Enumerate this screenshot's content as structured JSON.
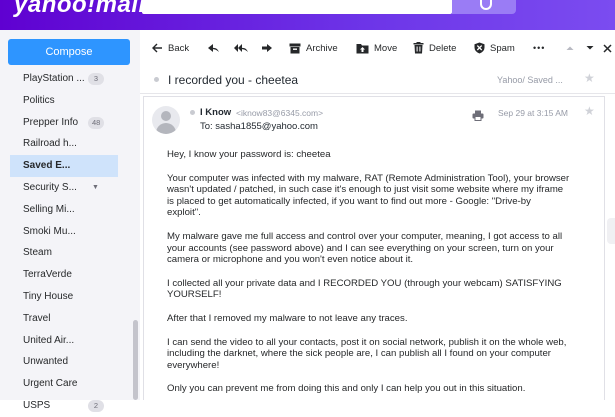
{
  "header": {
    "logo": "yahoo!mail"
  },
  "sidebar": {
    "compose_label": "Compose",
    "folders": [
      {
        "label": "PlayStation ...",
        "count": "3"
      },
      {
        "label": "Politics",
        "count": ""
      },
      {
        "label": "Prepper Info",
        "count": "48"
      },
      {
        "label": "Railroad h...",
        "count": ""
      },
      {
        "label": "Saved E...",
        "count": "",
        "selected": true
      },
      {
        "label": "Security S...",
        "count": "",
        "expandable": true
      },
      {
        "label": "Selling Mi...",
        "count": ""
      },
      {
        "label": "Smoki Mu...",
        "count": ""
      },
      {
        "label": "Steam",
        "count": ""
      },
      {
        "label": "TerraVerde",
        "count": ""
      },
      {
        "label": "Tiny House",
        "count": ""
      },
      {
        "label": "Travel",
        "count": ""
      },
      {
        "label": "United Air...",
        "count": ""
      },
      {
        "label": "Unwanted",
        "count": ""
      },
      {
        "label": "Urgent Care",
        "count": ""
      },
      {
        "label": "USPS",
        "count": "2"
      }
    ]
  },
  "toolbar": {
    "back": "Back",
    "archive": "Archive",
    "move": "Move",
    "delete": "Delete",
    "spam": "Spam",
    "more": "•••"
  },
  "message": {
    "subject": "I recorded you - cheetea",
    "folder": "Yahoo/ Saved ...",
    "sender_name": "I Know",
    "sender_email": "<iknow83@6345.com>",
    "to": "To: sasha1855@yahoo.com",
    "date": "Sep 29 at 3:15 AM",
    "paragraphs": [
      "Hey, I know your password is: cheetea",
      "Your computer was infected with my malware, RAT (Remote Administration Tool), your browser\nwasn't updated / patched, in such case it's enough to just visit some website where my iframe\nis placed to get automatically infected, if you want to find out more - Google: \"Drive-by\nexploit\".",
      "My malware gave me full access and control over your computer, meaning, I got access to all\nyour accounts (see password above) and I can see everything on your screen, turn on your\ncamera or microphone and you won't even notice about it.",
      "I collected all your private data and I RECORDED YOU (through your webcam) SATISFYING\nYOURSELF!",
      "After that I removed my malware to not leave any traces.",
      "I can send the video to all your contacts, post it on social network, publish it on the whole web,\nincluding the darknet, where the sick people are, I can publish all I found on your computer\neverywhere!",
      "Only you can prevent me from doing this and only I can help you out in this situation."
    ]
  }
}
